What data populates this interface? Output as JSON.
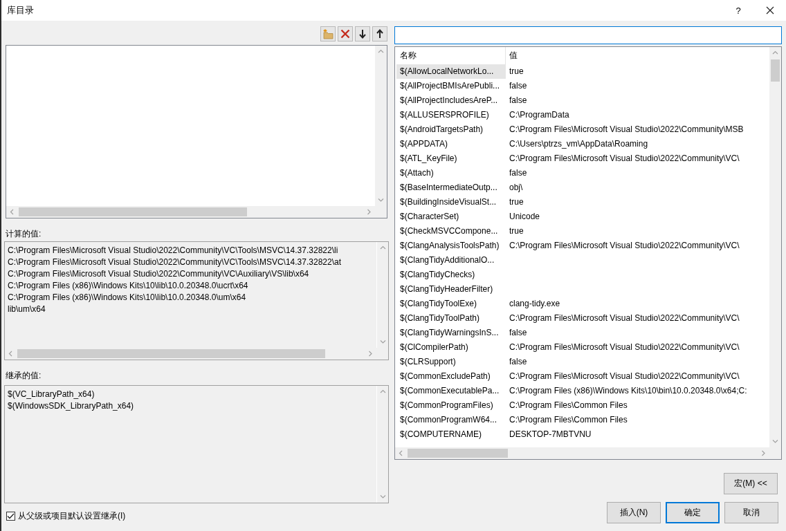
{
  "window": {
    "title": "库目录",
    "help": "?"
  },
  "computed": {
    "label": "计算的值:",
    "lines": [
      "C:\\Program Files\\Microsoft Visual Studio\\2022\\Community\\VC\\Tools\\MSVC\\14.37.32822\\li",
      "C:\\Program Files\\Microsoft Visual Studio\\2022\\Community\\VC\\Tools\\MSVC\\14.37.32822\\at",
      "C:\\Program Files\\Microsoft Visual Studio\\2022\\Community\\VC\\Auxiliary\\VS\\lib\\x64",
      "C:\\Program Files (x86)\\Windows Kits\\10\\lib\\10.0.20348.0\\ucrt\\x64",
      "C:\\Program Files (x86)\\Windows Kits\\10\\lib\\10.0.20348.0\\um\\x64",
      "lib\\um\\x64"
    ]
  },
  "inherited": {
    "label": "继承的值:",
    "lines": [
      "$(VC_LibraryPath_x64)",
      "$(WindowsSDK_LibraryPath_x64)"
    ]
  },
  "inherit_checkbox": {
    "label": "从父级或项目默认设置继承(I)",
    "checked": true
  },
  "macros": {
    "columns": [
      "名称",
      "值"
    ],
    "rows": [
      {
        "name": "$(AllowLocalNetworkLo...",
        "value": "true",
        "selected": true
      },
      {
        "name": "$(AllProjectBMIsArePubli...",
        "value": "false",
        "selected": false
      },
      {
        "name": "$(AllProjectIncludesAreP...",
        "value": "false",
        "selected": false
      },
      {
        "name": "$(ALLUSERSPROFILE)",
        "value": "C:\\ProgramData",
        "selected": false
      },
      {
        "name": "$(AndroidTargetsPath)",
        "value": "C:\\Program Files\\Microsoft Visual Studio\\2022\\Community\\MSB",
        "selected": false
      },
      {
        "name": "$(APPDATA)",
        "value": "C:\\Users\\ptrzs_vm\\AppData\\Roaming",
        "selected": false
      },
      {
        "name": "$(ATL_KeyFile)",
        "value": "C:\\Program Files\\Microsoft Visual Studio\\2022\\Community\\VC\\",
        "selected": false
      },
      {
        "name": "$(Attach)",
        "value": "false",
        "selected": false
      },
      {
        "name": "$(BaseIntermediateOutp...",
        "value": "obj\\",
        "selected": false
      },
      {
        "name": "$(BuildingInsideVisualSt...",
        "value": "true",
        "selected": false
      },
      {
        "name": "$(CharacterSet)",
        "value": "Unicode",
        "selected": false
      },
      {
        "name": "$(CheckMSVCCompone...",
        "value": "true",
        "selected": false
      },
      {
        "name": "$(ClangAnalysisToolsPath)",
        "value": "C:\\Program Files\\Microsoft Visual Studio\\2022\\Community\\VC\\",
        "selected": false
      },
      {
        "name": "$(ClangTidyAdditionalO...",
        "selected": false
      },
      {
        "name": "$(ClangTidyChecks)",
        "selected": false
      },
      {
        "name": "$(ClangTidyHeaderFilter)",
        "selected": false
      },
      {
        "name": "$(ClangTidyToolExe)",
        "value": "clang-tidy.exe",
        "selected": false
      },
      {
        "name": "$(ClangTidyToolPath)",
        "value": "C:\\Program Files\\Microsoft Visual Studio\\2022\\Community\\VC\\",
        "selected": false
      },
      {
        "name": "$(ClangTidyWarningsInS...",
        "value": "false",
        "selected": false
      },
      {
        "name": "$(ClCompilerPath)",
        "value": "C:\\Program Files\\Microsoft Visual Studio\\2022\\Community\\VC\\",
        "selected": false
      },
      {
        "name": "$(CLRSupport)",
        "value": "false",
        "selected": false
      },
      {
        "name": "$(CommonExcludePath)",
        "value": "C:\\Program Files\\Microsoft Visual Studio\\2022\\Community\\VC\\",
        "selected": false
      },
      {
        "name": "$(CommonExecutablePa...",
        "value": "C:\\Program Files (x86)\\Windows Kits\\10\\bin\\10.0.20348.0\\x64;C:",
        "selected": false
      },
      {
        "name": "$(CommonProgramFiles)",
        "value": "C:\\Program Files\\Common Files",
        "selected": false
      },
      {
        "name": "$(CommonProgramW64...",
        "value": "C:\\Program Files\\Common Files",
        "selected": false
      },
      {
        "name": "$(COMPUTERNAME)",
        "value": "DESKTOP-7MBTVNU",
        "selected": false
      }
    ]
  },
  "macro_button": {
    "label": "宏(M) <<"
  },
  "buttons": [
    {
      "label": "插入(N)",
      "default": false
    },
    {
      "label": "确定",
      "default": true
    },
    {
      "label": "取消",
      "default": false
    }
  ]
}
